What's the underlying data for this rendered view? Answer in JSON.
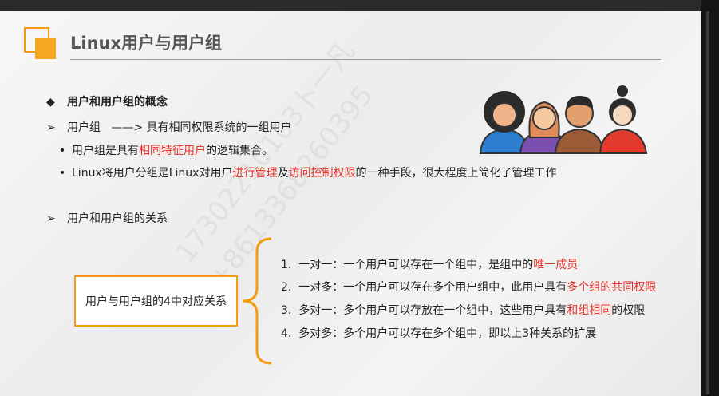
{
  "slide": {
    "title": "Linux用户与用户组",
    "watermark_1": "17302210103卜一凡",
    "watermark_2": "+8613368260395",
    "heading_concept": "用户和用户组的概念",
    "user_group_line": {
      "term": "用户组",
      "arrow": "——>",
      "definition": "具有相同权限系统的一组用户"
    },
    "bullet_1": {
      "pre": "用户组是具有",
      "highlight": "相同特征用户",
      "post": "的逻辑集合。"
    },
    "bullet_2": {
      "pre": "Linux将用户分组是Linux对用户",
      "highlight_1": "进行管理",
      "mid": "及",
      "highlight_2": "访问控制权限",
      "post": "的一种手段，很大程度上简化了管理工作"
    },
    "heading_relation": "用户和用户组的关系",
    "relation_box": "用户与用户组的4中对应关系",
    "relations": [
      {
        "num": "1.",
        "pre": "一对一：一个用户可以存在一个组中，是组中的",
        "highlight": "唯一成员",
        "post": ""
      },
      {
        "num": "2.",
        "pre": "一对多：一个用户可以存在多个用户组中，此用户具有",
        "highlight": "多个组的共同权限",
        "post": ""
      },
      {
        "num": "3.",
        "pre": "多对一：多个用户可以存放在一个组中，这些用户具有",
        "highlight": "和组相同",
        "post": "的权限"
      },
      {
        "num": "4.",
        "pre": "多对多：多个用户可以存在多个组中，即以上3种关系的扩展",
        "highlight": "",
        "post": ""
      }
    ],
    "bullets": {
      "diamond": "◆",
      "arrow": "➢",
      "dot": "•"
    },
    "colors": {
      "accent": "#f39c12",
      "highlight": "#e8322a"
    }
  }
}
